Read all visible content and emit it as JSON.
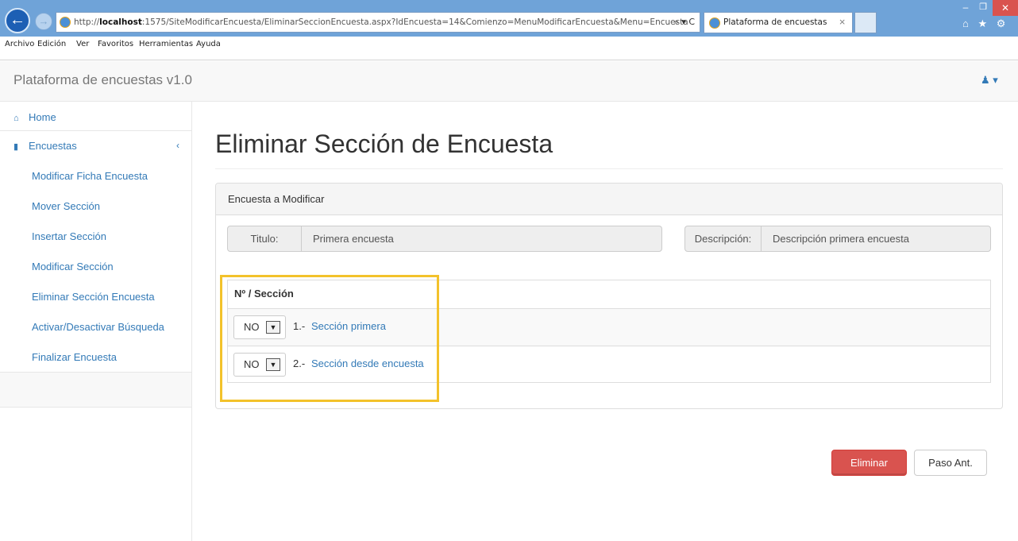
{
  "browser": {
    "url_prefix": "http://",
    "url_host": "localhost",
    "url_rest": ":1575/SiteModificarEncuesta/EliminarSeccionEncuesta.aspx?IdEncuesta=14&Comienzo=MenuModificarEncuesta&Menu=Encuesta",
    "addr_actions": "⌕ ▾ C",
    "tab_title": "Plataforma de encuestas",
    "tab_close": "×",
    "right_icons": "⌂ ★ ⚙",
    "menu": [
      "Archivo",
      "Edición",
      "Ver",
      "Favoritos",
      "Herramientas",
      "Ayuda"
    ]
  },
  "navbar": {
    "brand": "Plataforma de encuestas v1.0",
    "user_menu": "♟ ▾"
  },
  "sidebar": {
    "home": "Home",
    "home_icon": "⌂",
    "encuestas": "Encuestas",
    "encuestas_icon": "▮",
    "chevron": "‹",
    "items": [
      "Modificar Ficha Encuesta",
      "Mover Sección",
      "Insertar Sección",
      "Modificar Sección",
      "Eliminar Sección Encuesta",
      "Activar/Desactivar Búsqueda",
      "Finalizar Encuesta"
    ]
  },
  "main": {
    "title": "Eliminar Sección de Encuesta",
    "panel_heading": "Encuesta a Modificar",
    "titulo_label": "Titulo:",
    "titulo_value": "Primera encuesta",
    "descripcion_label": "Descripción:",
    "descripcion_value": "Descripción primera encuesta",
    "table_header": "Nº / Sección",
    "sections": [
      {
        "select": "NO",
        "num": "1.-",
        "name": "Sección primera"
      },
      {
        "select": "NO",
        "num": "2.-",
        "name": "Sección desde encuesta"
      }
    ]
  },
  "buttons": {
    "eliminar": "Eliminar",
    "paso_ant": "Paso Ant."
  },
  "colors": {
    "link": "#337ab7",
    "danger": "#d9534f",
    "highlight": "#f3c22b"
  }
}
